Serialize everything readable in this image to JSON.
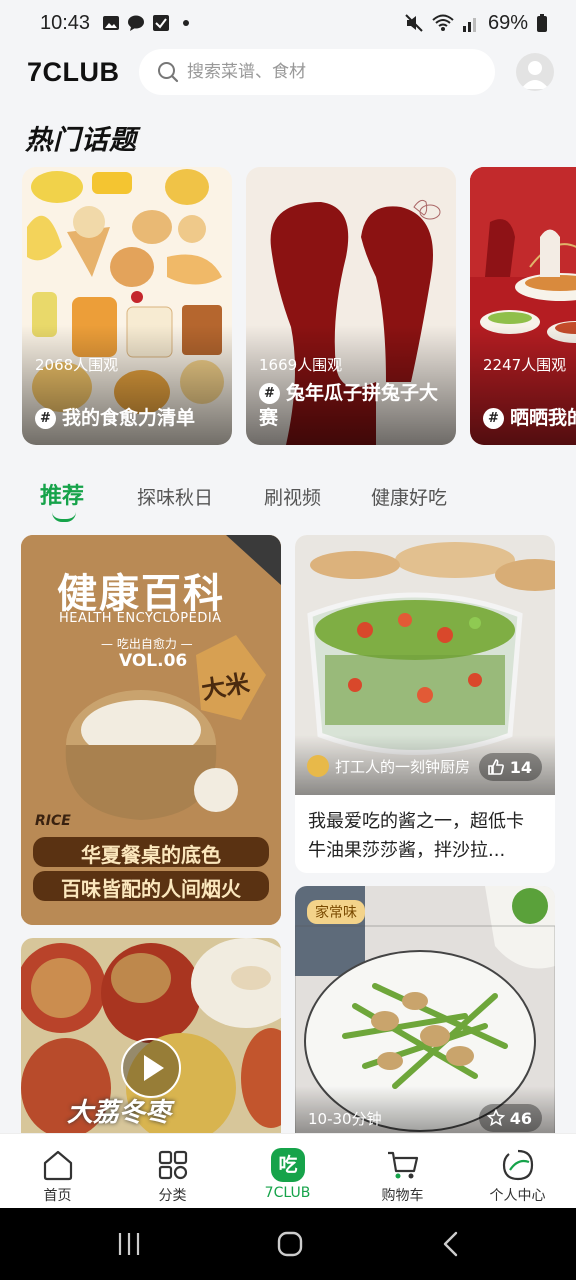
{
  "status_bar": {
    "time": "10:43",
    "battery": "69%"
  },
  "header": {
    "logo": "7CLUB",
    "search_placeholder": "搜索菜谱、食材"
  },
  "hot_topics": {
    "title": "热门话题",
    "items": [
      {
        "views": "2068人围观",
        "name": "我的食愈力清单"
      },
      {
        "views": "1669人围观",
        "name": "兔年瓜子拼兔子大赛"
      },
      {
        "views": "2247人围观",
        "name": "晒晒我的"
      }
    ]
  },
  "tabs": [
    "推荐",
    "探味秋日",
    "刷视频",
    "健康好吃"
  ],
  "feed": {
    "cards": [
      {
        "image_text_title": "健康百科",
        "image_text_subtitle": "HEALTH ENCYCLOPEDIA",
        "image_text_series": "— 吃出自愈力 —",
        "image_text_vol": "VOL.06",
        "image_text_tag": "大米",
        "image_text_rice": "RICE",
        "image_text_line1": "华夏餐桌的底色",
        "image_text_line2": "百味皆配的人间烟火"
      },
      {
        "author": "打工人的一刻钟厨房",
        "likes": "14",
        "title": "我最爱吃的酱之一，超低卡牛油果莎莎酱，拌沙拉..."
      },
      {
        "image_text": "大荔冬枣"
      },
      {
        "tag": "家常味",
        "duration": "10-30分钟",
        "favorites": "46"
      }
    ]
  },
  "bottom_nav": [
    {
      "label": "首页",
      "icon": "home-icon"
    },
    {
      "label": "分类",
      "icon": "category-grid-icon"
    },
    {
      "label": "7CLUB",
      "icon": "eat-badge-icon",
      "badge": "吃"
    },
    {
      "label": "购物车",
      "icon": "cart-icon"
    },
    {
      "label": "个人中心",
      "icon": "profile-icon"
    }
  ],
  "colors": {
    "accent": "#16a34a",
    "background": "#f4f5f7"
  }
}
